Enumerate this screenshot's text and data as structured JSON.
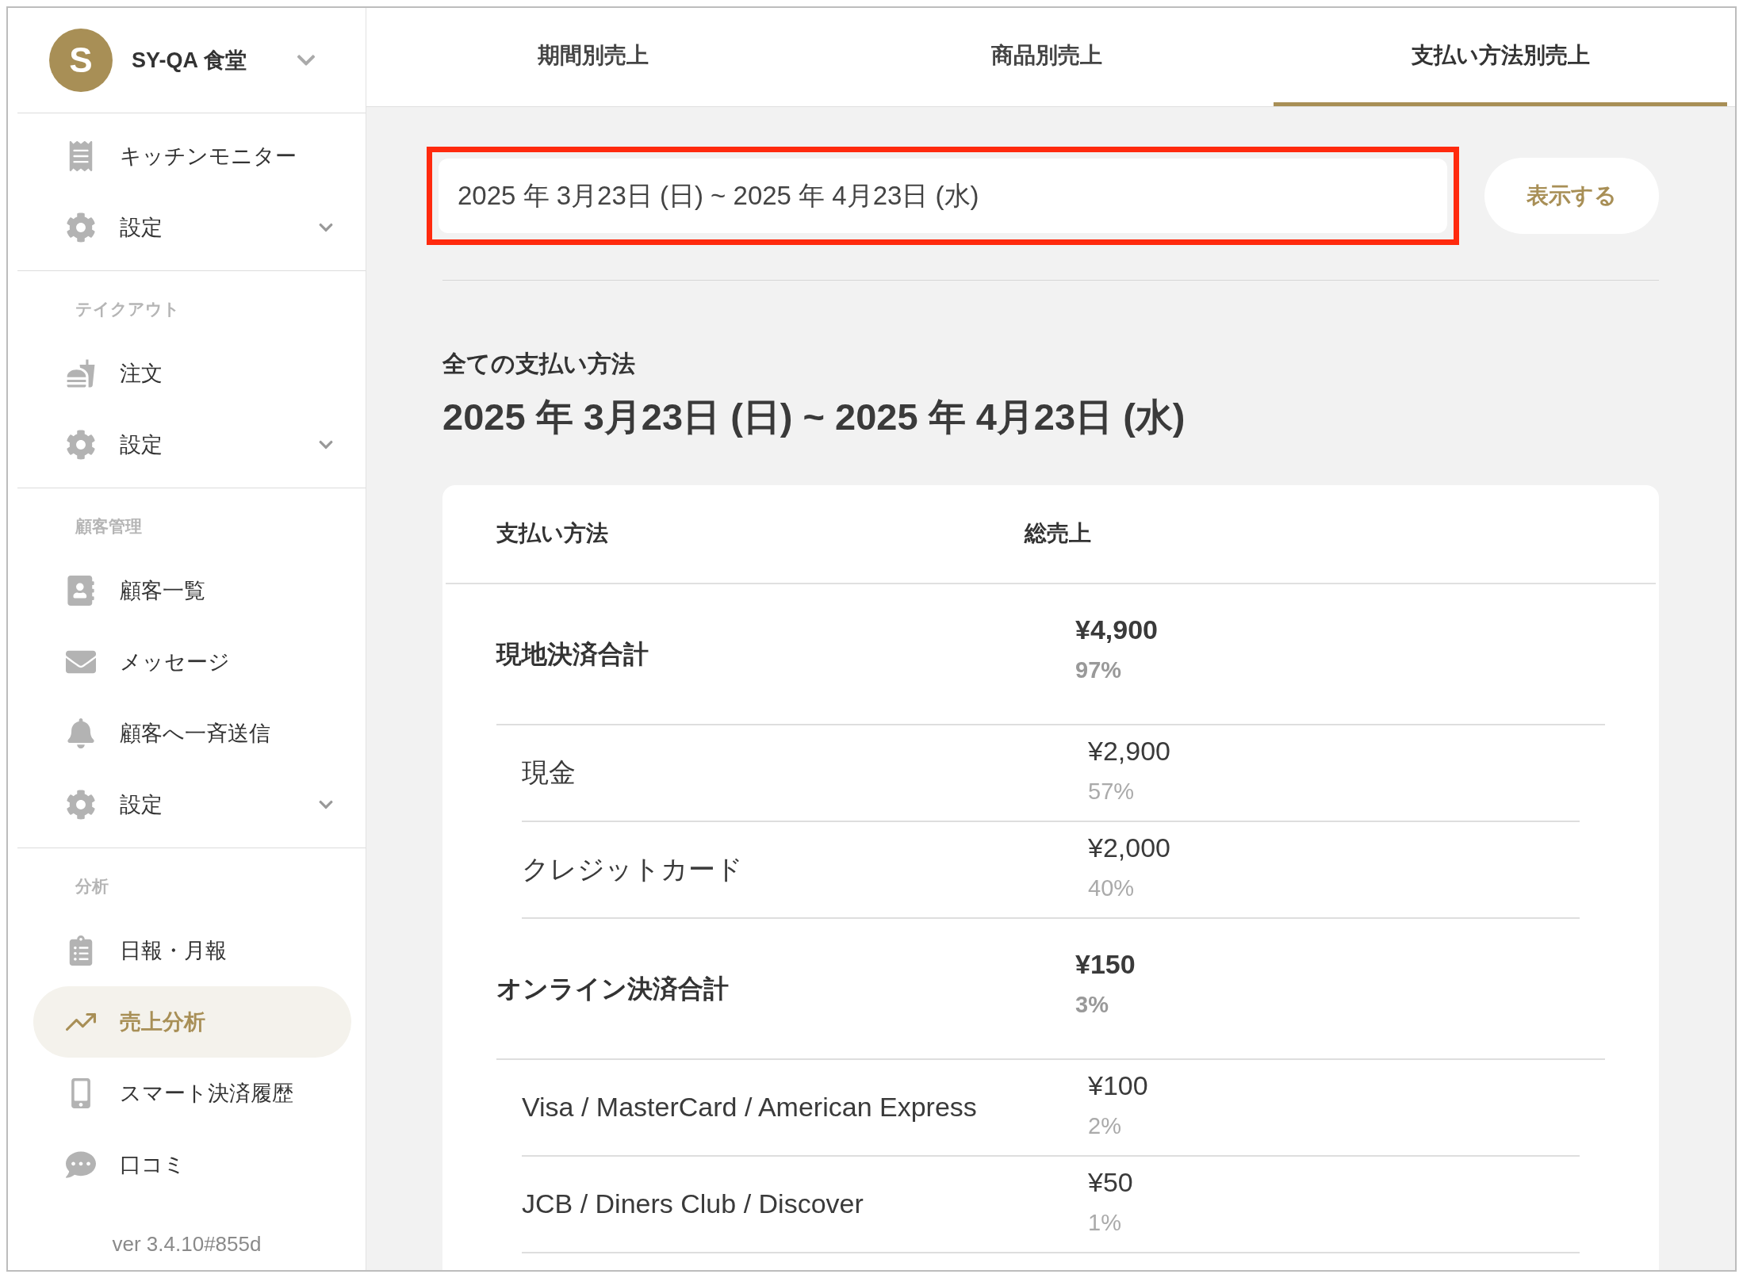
{
  "sidebar": {
    "account": {
      "initial": "S",
      "name": "SY-QA 食堂"
    },
    "sections": [
      {
        "items": [
          {
            "kind": "link",
            "label": "キッチンモニター",
            "selected": false
          },
          {
            "kind": "menu",
            "label": "設定",
            "selected": false
          }
        ]
      },
      {
        "heading": "テイクアウト",
        "items": [
          {
            "kind": "link",
            "label": "注文",
            "selected": false
          },
          {
            "kind": "menu",
            "label": "設定",
            "selected": false
          }
        ]
      },
      {
        "heading": "顧客管理",
        "items": [
          {
            "kind": "link",
            "label": "顧客一覧",
            "selected": false
          },
          {
            "kind": "link",
            "label": "メッセージ",
            "selected": false
          },
          {
            "kind": "link",
            "label": "顧客へ一斉送信",
            "selected": false
          },
          {
            "kind": "menu",
            "label": "設定",
            "selected": false
          }
        ]
      },
      {
        "heading": "分析",
        "items": [
          {
            "kind": "link",
            "label": "日報・月報",
            "selected": false
          },
          {
            "kind": "link",
            "label": "売上分析",
            "selected": true
          },
          {
            "kind": "link",
            "label": "スマート決済履歴",
            "selected": false
          },
          {
            "kind": "link",
            "label": "口コミ",
            "selected": false
          }
        ]
      }
    ],
    "version": "ver 3.4.10#855d"
  },
  "tabs": [
    {
      "label": "期間別売上",
      "selected": false
    },
    {
      "label": "商品別売上",
      "selected": false
    },
    {
      "label": "支払い方法別売上",
      "selected": true
    }
  ],
  "date_filter": {
    "value": "2025 年 3月23日 (日) ~ 2025 年 4月23日 (水)",
    "button": "表示する"
  },
  "summary": {
    "title": "全ての支払い方法",
    "period": "2025 年 3月23日 (日) ~ 2025 年 4月23日 (水)"
  },
  "table": {
    "columns": [
      "支払い方法",
      "総売上"
    ],
    "rows": [
      {
        "kind": "total",
        "label": "現地決済合計",
        "amount": "¥4,900",
        "share": "97%"
      },
      {
        "kind": "method",
        "label": "現金",
        "amount": "¥2,900",
        "share": "57%"
      },
      {
        "kind": "method",
        "label": "クレジットカード",
        "amount": "¥2,000",
        "share": "40%"
      },
      {
        "kind": "total",
        "label": "オンライン決済合計",
        "amount": "¥150",
        "share": "3%"
      },
      {
        "kind": "method",
        "label": "Visa / MasterCard / American Express",
        "amount": "¥100",
        "share": "2%"
      },
      {
        "kind": "method",
        "label": "JCB / Diners Club / Discover",
        "amount": "¥50",
        "share": "1%"
      }
    ]
  }
}
